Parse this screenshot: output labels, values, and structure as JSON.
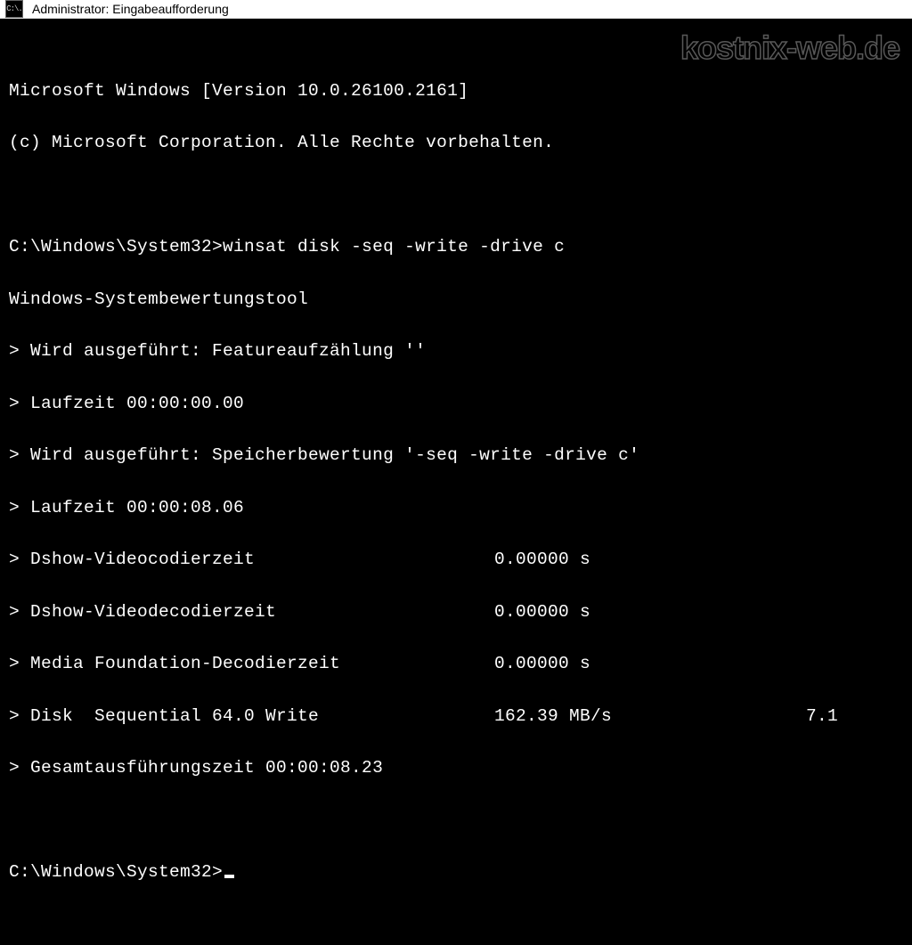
{
  "window": {
    "icon_text": "C:\\.",
    "title": "Administrator: Eingabeaufforderung"
  },
  "watermark": "kostnix-web.de",
  "terminal": {
    "header1": "Microsoft Windows [Version 10.0.26100.2161]",
    "header2": "(c) Microsoft Corporation. Alle Rechte vorbehalten.",
    "prompt1_path": "C:\\Windows\\System32>",
    "prompt1_cmd": "winsat disk -seq -write -drive c",
    "tool_name": "Windows-Systembewertungstool",
    "line_feat": "> Wird ausgeführt: Featureaufzählung ''",
    "line_rt1": "> Laufzeit 00:00:00.00",
    "line_stor": "> Wird ausgeführt: Speicherbewertung '-seq -write -drive c'",
    "line_rt2": "> Laufzeit 00:00:08.06",
    "rows": [
      {
        "label": "> Dshow-Videocodierzeit",
        "val": "0.00000 s",
        "score": ""
      },
      {
        "label": "> Dshow-Videodecodierzeit",
        "val": "0.00000 s",
        "score": ""
      },
      {
        "label": "> Media Foundation-Decodierzeit",
        "val": "0.00000 s",
        "score": ""
      },
      {
        "label": "> Disk  Sequential 64.0 Write",
        "val": "162.39 MB/s",
        "score": "7.1"
      }
    ],
    "line_total": "> Gesamtausführungszeit 00:00:08.23",
    "prompt2_path": "C:\\Windows\\System32>"
  }
}
